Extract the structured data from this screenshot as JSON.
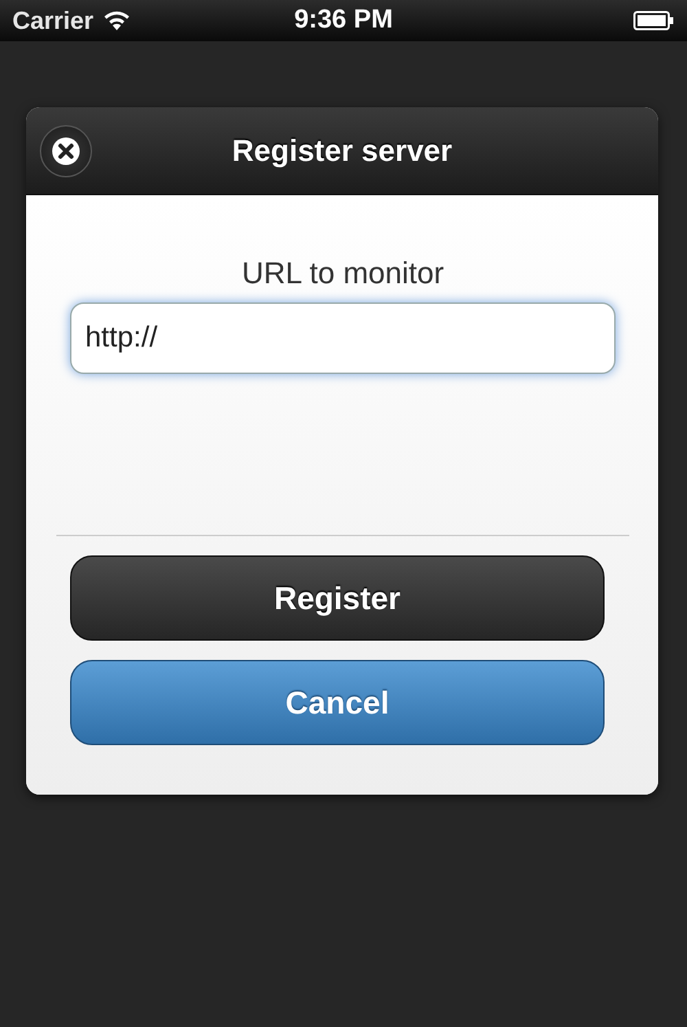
{
  "status_bar": {
    "carrier": "Carrier",
    "time": "9:36 PM"
  },
  "dialog": {
    "title": "Register server",
    "field": {
      "label": "URL to monitor",
      "value": "http://"
    },
    "buttons": [
      {
        "label": "Register",
        "kind": "dark"
      },
      {
        "label": "Cancel",
        "kind": "primary"
      }
    ]
  }
}
